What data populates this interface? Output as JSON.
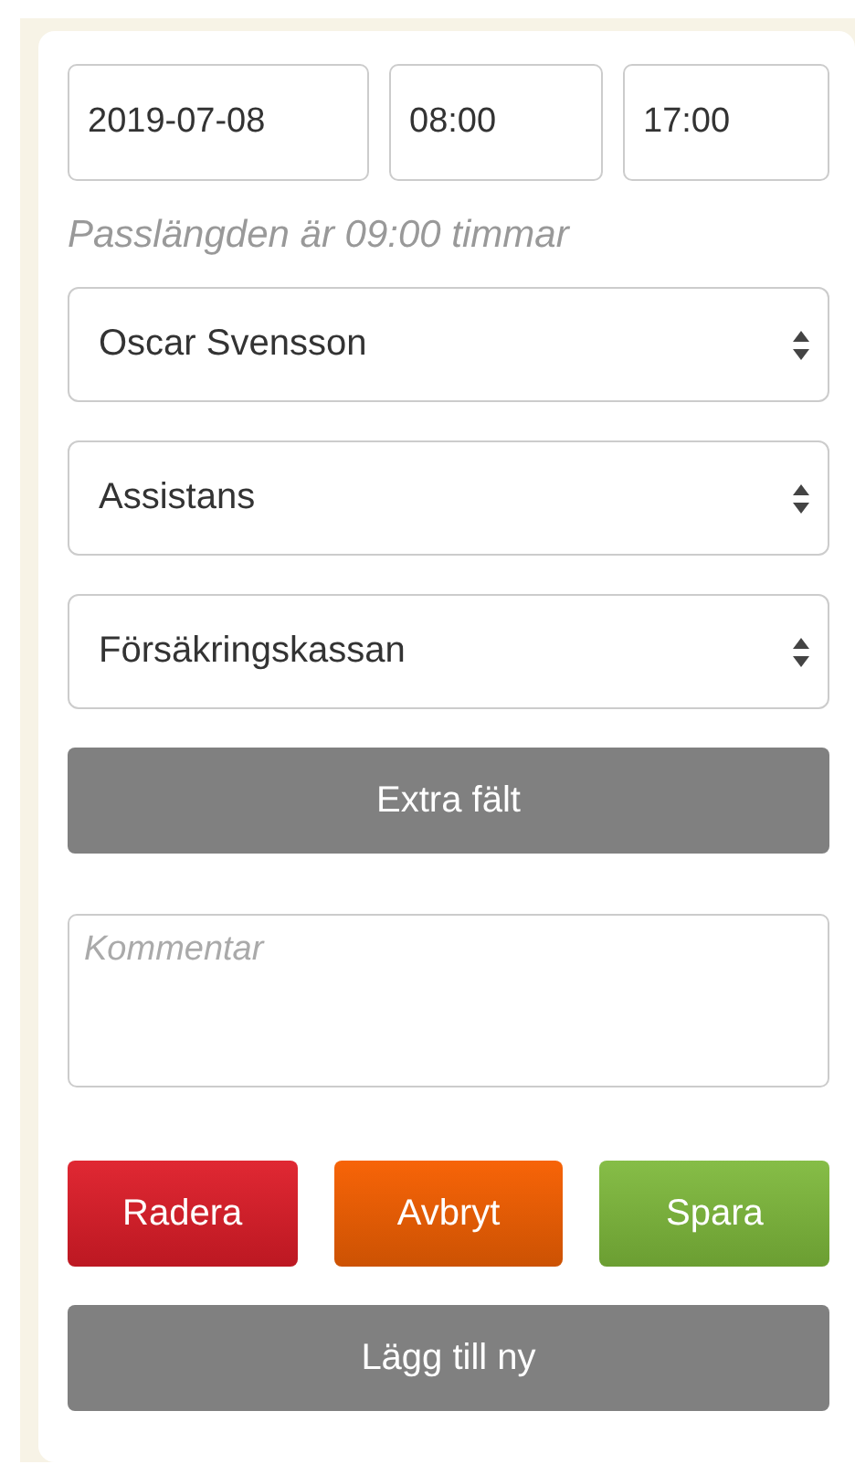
{
  "date_fields": [
    {
      "value": "2019-07-08"
    },
    {
      "value": "08:00"
    },
    {
      "value": "17:00"
    }
  ],
  "duration_note": "Passlängden är 09:00 timmar",
  "selects": [
    {
      "value": "Oscar Svensson"
    },
    {
      "value": "Assistans"
    },
    {
      "value": "Försäkringskassan"
    }
  ],
  "extra_button": "Extra fält",
  "comment": {
    "placeholder": "Kommentar"
  },
  "action_buttons": [
    {
      "label": "Radera",
      "kind": "danger"
    },
    {
      "label": "Avbryt",
      "kind": "warning"
    },
    {
      "label": "Spara",
      "kind": "success"
    }
  ],
  "add_button": "Lägg till ny"
}
